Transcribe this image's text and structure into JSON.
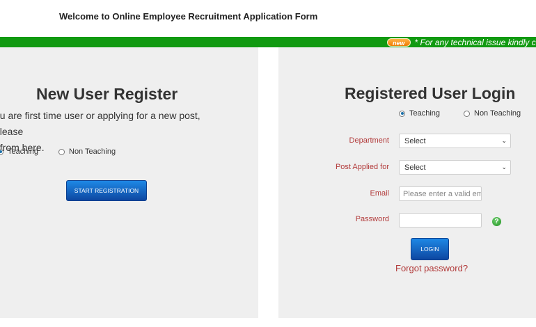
{
  "header": {
    "title": "Welcome to Online Employee Recruitment Application Form"
  },
  "ticker": {
    "badge": "new",
    "message": "* For any technical issue kindly c"
  },
  "register": {
    "title": "New User Register",
    "description_line1": "ou are first time user or applying for a new post, please",
    "description_line2": "t from here.",
    "options": [
      "Teaching",
      "Non Teaching"
    ],
    "selected": "Teaching",
    "button_label": "START REGISTRATION"
  },
  "login": {
    "title": "Registered User Login",
    "options": [
      "Teaching",
      "Non Teaching"
    ],
    "selected": "Teaching",
    "department_label": "Department",
    "department_value": "Select",
    "post_label": "Post Applied for",
    "post_value": "Select",
    "email_label": "Email",
    "email_placeholder": "Please enter a valid email",
    "password_label": "Password",
    "password_value": "",
    "help_glyph": "?",
    "button_label": "LOGIN",
    "forgot_label": "Forgot password?"
  },
  "colors": {
    "ticker_bg": "#119a11",
    "panel_bg": "#efefef",
    "label_red": "#b23b3b",
    "button_blue": "#1565c0"
  }
}
